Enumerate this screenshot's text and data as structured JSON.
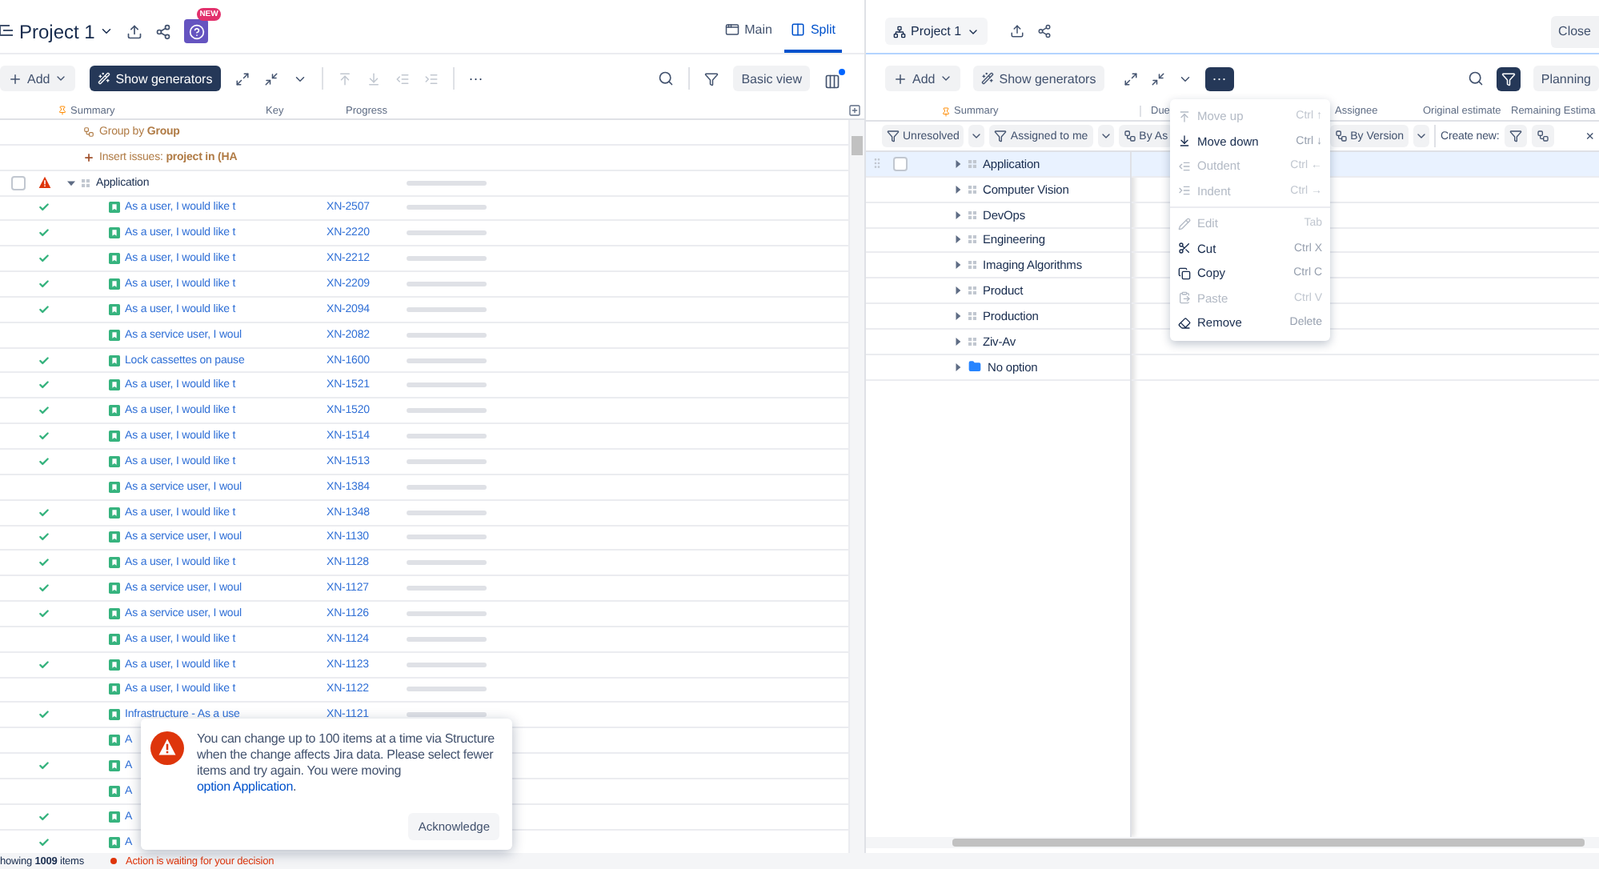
{
  "left_panel": {
    "title": "Project 1",
    "new_badge": "NEW",
    "view_tabs": [
      {
        "label": "Main",
        "selected": false
      },
      {
        "label": "Split",
        "selected": true
      }
    ],
    "toolbar": {
      "add": "Add",
      "generators": "Show generators",
      "move_tools_disabled": true,
      "more": "···",
      "view": "Basic view",
      "columns_changed": true
    },
    "columns": [
      "Summary",
      "Key",
      "Progress"
    ],
    "group_row": "Group by **Group**",
    "insert_row": "Insert issues: **project in (HA**",
    "root": {
      "label": "Application",
      "checked": false,
      "alert": true,
      "expanded": true,
      "level": 0
    },
    "rows": [
      {
        "summary": "As a user, I would like t",
        "key": "XN-2507",
        "done": true,
        "level": 0
      },
      {
        "summary": "As a user, I would like t",
        "key": "XN-2220",
        "done": true,
        "level": 0
      },
      {
        "summary": "As a user, I would like t",
        "key": "XN-2212",
        "done": true,
        "level": 0
      },
      {
        "summary": "As a user, I would like t",
        "key": "XN-2209",
        "done": true,
        "level": 0
      },
      {
        "summary": "As a user, I would like t",
        "key": "XN-2094",
        "done": true,
        "level": 0
      },
      {
        "summary": "As a service user, I woul",
        "key": "XN-2082",
        "done": false,
        "level": 0
      },
      {
        "summary": "Lock cassettes on pause",
        "key": "XN-1600",
        "done": true,
        "level": 0
      },
      {
        "summary": "As a user, I would like t",
        "key": "XN-1521",
        "done": true,
        "level": 0
      },
      {
        "summary": "As a user, I would like t",
        "key": "XN-1520",
        "done": true,
        "level": 0
      },
      {
        "summary": "As a user, I would like t",
        "key": "XN-1514",
        "done": true,
        "level": 0
      },
      {
        "summary": "As a user, I would like t",
        "key": "XN-1513",
        "done": true,
        "level": 0
      },
      {
        "summary": "As a service user, I woul",
        "key": "XN-1384",
        "done": false,
        "level": 0
      },
      {
        "summary": "As a user, I would like t",
        "key": "XN-1348",
        "done": true,
        "level": 0
      },
      {
        "summary": "As a service user, I woul",
        "key": "XN-1130",
        "done": true,
        "level": 0
      },
      {
        "summary": "As a user, I would like t",
        "key": "XN-1128",
        "done": true,
        "level": 0
      },
      {
        "summary": "As a service user, I woul",
        "key": "XN-1127",
        "done": true,
        "level": 0
      },
      {
        "summary": "As a service user, I woul",
        "key": "XN-1126",
        "done": true,
        "level": 0
      },
      {
        "summary": "As a user, I would like t",
        "key": "XN-1124",
        "done": false,
        "level": 0
      },
      {
        "summary": "As a user, I would like t",
        "key": "XN-1123",
        "done": true,
        "level": 0
      },
      {
        "summary": "As a user, I would like t",
        "key": "XN-1122",
        "done": false,
        "level": 0
      },
      {
        "summary": "Infrastructure - As a use",
        "key": "XN-1121",
        "done": true,
        "level": 0
      },
      {
        "summary": "A",
        "done": false
      },
      {
        "summary": "A",
        "done": true
      },
      {
        "summary": "A",
        "done": false
      },
      {
        "summary": "A",
        "done": true
      },
      {
        "summary": "A",
        "done": true
      }
    ]
  },
  "right_panel": {
    "title": "Project 1",
    "close": "Close",
    "toolbar": {
      "add": "Add",
      "generators": "Show generators",
      "more": "···",
      "more_active": true,
      "filter_active": true,
      "view": "Planning"
    },
    "columns": [
      "Summary",
      "Due",
      "Assignee",
      "Original estimate",
      "Remaining Estima"
    ],
    "filters": [
      {
        "label": "Unresolved",
        "kind": "filter",
        "dropdown": true
      },
      {
        "label": "Assigned to me",
        "kind": "filter",
        "dropdown": true
      },
      {
        "label": "By As",
        "kind": "group",
        "dropdown": false
      },
      {
        "label": "By Version",
        "kind": "group",
        "dropdown": true
      }
    ],
    "create_new": "Create new:",
    "dismiss": "×",
    "tree": [
      {
        "label": "Application",
        "kind": "group",
        "selected": true
      },
      {
        "label": "Computer Vision",
        "kind": "group",
        "selected": false
      },
      {
        "label": "DevOps",
        "kind": "group",
        "selected": false
      },
      {
        "label": "Engineering",
        "kind": "group",
        "selected": false
      },
      {
        "label": "Imaging Algorithms",
        "kind": "group",
        "selected": false
      },
      {
        "label": "Product",
        "kind": "group",
        "selected": false
      },
      {
        "label": "Production",
        "kind": "group",
        "selected": false
      },
      {
        "label": "Ziv-Av",
        "kind": "group",
        "selected": false
      },
      {
        "label": "No option",
        "kind": "empty",
        "selected": false
      }
    ]
  },
  "menu": {
    "groups": [
      [
        {
          "label": "Move up",
          "shortcut": "Ctrl ↑",
          "disabled": true
        },
        {
          "label": "Move down",
          "shortcut": "Ctrl ↓",
          "disabled": false
        },
        {
          "label": "Outdent",
          "shortcut": "Ctrl ←",
          "disabled": true
        },
        {
          "label": "Indent",
          "shortcut": "Ctrl →",
          "disabled": true
        }
      ],
      [
        {
          "label": "Edit",
          "shortcut": "Tab",
          "disabled": true
        },
        {
          "label": "Cut",
          "shortcut": "Ctrl X",
          "disabled": false
        },
        {
          "label": "Copy",
          "shortcut": "Ctrl C",
          "disabled": false
        },
        {
          "label": "Paste",
          "shortcut": "Ctrl V",
          "disabled": true
        },
        {
          "label": "Remove",
          "shortcut": "Delete",
          "disabled": false
        }
      ]
    ]
  },
  "dialog": {
    "message": "You can change up to 100 items at a time via Structure when the change affects Jira data. Please select fewer items and try again. You were moving",
    "link": "option Application",
    "message_end": ".",
    "button": "Acknowledge"
  },
  "status_bar": {
    "count": "howing **1009** items",
    "alert": "Action is waiting for your decision"
  }
}
